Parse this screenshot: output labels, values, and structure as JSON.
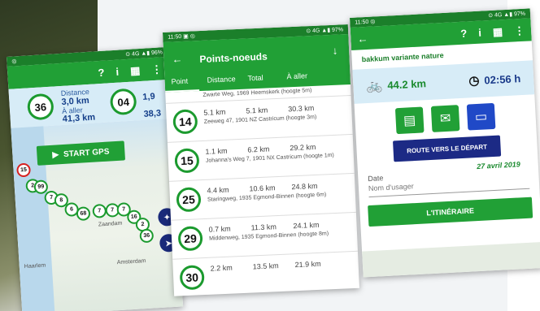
{
  "phone1": {
    "status_left": "◎",
    "status_right": "⊙ 4G ▲▮ 96%",
    "info": {
      "node": "36",
      "distance_label": "Distance",
      "distance_value": "3,0 km",
      "aller_label": "À aller",
      "aller_value": "41,3 km",
      "node2": "04",
      "distance_value2": "1,9",
      "aller_value2": "38,3"
    },
    "start_gps": "START GPS",
    "map_nodes": [
      "15",
      "2",
      "99",
      "7",
      "8",
      "6",
      "68",
      "7",
      "7",
      "7",
      "16",
      "2",
      "36"
    ],
    "map_labels": [
      "Zaandam",
      "Haarlem",
      "Amsterdam"
    ]
  },
  "phone2": {
    "status_left": "11:50 ▣ ◎",
    "status_right": "⊙ 4G ▲▮ 97%",
    "title": "Points-noeuds",
    "columns": [
      "Point",
      "Distance",
      "Total",
      "À aller"
    ],
    "top_addr": "Zwarte Weg, 1969 Heemskerk (hoogte 5m)",
    "rows": [
      {
        "node": "14",
        "distance": "5.1 km",
        "total": "5.1 km",
        "aller": "30.3 km",
        "addr": "Zeeweg 47, 1901 NZ Castricum (hoogte 3m)"
      },
      {
        "node": "15",
        "distance": "1.1 km",
        "total": "6.2 km",
        "aller": "29.2 km",
        "addr": "Johanna's Weg 7, 1901 NX Castricum (hoogte 1m)"
      },
      {
        "node": "25",
        "distance": "4.4 km",
        "total": "10.6 km",
        "aller": "24.8 km",
        "addr": "Staringweg, 1935 Egmond-Binnen (hoogte 6m)"
      },
      {
        "node": "29",
        "distance": "0.7 km",
        "total": "11.3 km",
        "aller": "24.1 km",
        "addr": "Middenweg, 1935 Egmond-Binnen (hoogte 8m)"
      },
      {
        "node": "30",
        "distance": "2.2 km",
        "total": "13.5 km",
        "aller": "21.9 km",
        "addr": ""
      }
    ]
  },
  "phone3": {
    "status_left": "11:50 ◎",
    "status_right": "⊙ 4G ▲▮ 97%",
    "route_name": "bakkum variante nature",
    "distance": "44.2 km",
    "time": "02:56 h",
    "route_button": "ROUTE VERS LE DÉPART",
    "date_label": "Date",
    "date_value": "27 avril 2019",
    "username_placeholder": "Nom d'usager",
    "itinerary_button": "L'ITINÉRAIRE"
  },
  "colors": {
    "green": "#21a036",
    "dark_green": "#1b7f2a",
    "navy": "#1c2a85",
    "light_blue": "#d7ecf7"
  }
}
